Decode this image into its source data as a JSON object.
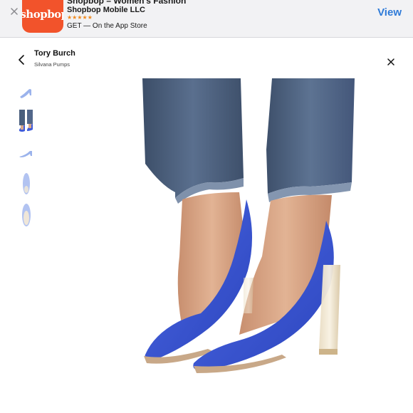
{
  "app_banner": {
    "title": "Shopbop – Women's Fashion",
    "developer": "Shopbop Mobile LLC",
    "rating_stars": "★★★★★",
    "get_text": "GET — On the App Store",
    "view_label": "View",
    "logo_text": "shopbop",
    "logo_color": "#f2532b"
  },
  "product": {
    "brand": "Tory Burch",
    "name": "Silvana Pumps"
  },
  "colors": {
    "shoe_blue": "#3f5bd9",
    "denim": "#4a5f7d",
    "view_link": "#2f7bd8"
  },
  "icons": {
    "close": "close-icon",
    "back": "chevron-left-icon",
    "modal_close": "close-icon"
  }
}
